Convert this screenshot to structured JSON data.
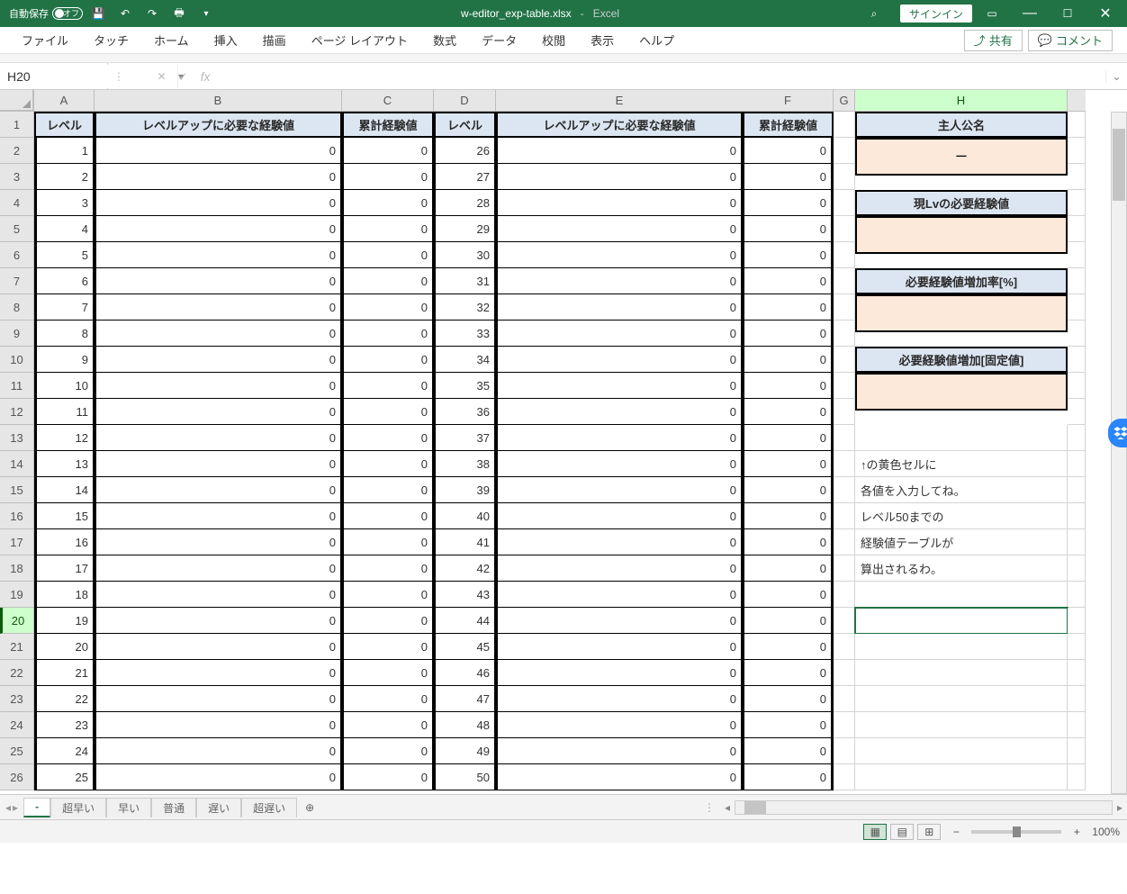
{
  "titlebar": {
    "autosave_label": "自動保存",
    "autosave_state": "オフ",
    "filename": "w-editor_exp-table.xlsx",
    "separator": "-",
    "appname": "Excel",
    "signin": "サインイン"
  },
  "ribbon": {
    "tabs": [
      "ファイル",
      "タッチ",
      "ホーム",
      "挿入",
      "描画",
      "ページ レイアウト",
      "数式",
      "データ",
      "校閲",
      "表示",
      "ヘルプ"
    ],
    "share": "共有",
    "comment": "コメント"
  },
  "namebox": "H20",
  "columns": [
    "A",
    "B",
    "C",
    "D",
    "E",
    "F",
    "G",
    "H"
  ],
  "headers": {
    "level": "レベル",
    "exp_needed": "レベルアップに必要な経験値",
    "cum_exp": "累計経験値"
  },
  "side_headers": {
    "protagonist": "主人公名",
    "current_lv_exp": "現Lvの必要経験値",
    "increase_percent": "必要経験値増加率[%]",
    "increase_fixed": "必要経験値増加[固定値]"
  },
  "side_values": {
    "protagonist": "ー"
  },
  "notes": [
    "↑の黄色セルに",
    "各値を入力してね。",
    "レベル50までの",
    "経験値テーブルが",
    "算出されるわ。"
  ],
  "rows_left": [
    {
      "level": 1,
      "need": 0,
      "cum": 0
    },
    {
      "level": 2,
      "need": 0,
      "cum": 0
    },
    {
      "level": 3,
      "need": 0,
      "cum": 0
    },
    {
      "level": 4,
      "need": 0,
      "cum": 0
    },
    {
      "level": 5,
      "need": 0,
      "cum": 0
    },
    {
      "level": 6,
      "need": 0,
      "cum": 0
    },
    {
      "level": 7,
      "need": 0,
      "cum": 0
    },
    {
      "level": 8,
      "need": 0,
      "cum": 0
    },
    {
      "level": 9,
      "need": 0,
      "cum": 0
    },
    {
      "level": 10,
      "need": 0,
      "cum": 0
    },
    {
      "level": 11,
      "need": 0,
      "cum": 0
    },
    {
      "level": 12,
      "need": 0,
      "cum": 0
    },
    {
      "level": 13,
      "need": 0,
      "cum": 0
    },
    {
      "level": 14,
      "need": 0,
      "cum": 0
    },
    {
      "level": 15,
      "need": 0,
      "cum": 0
    },
    {
      "level": 16,
      "need": 0,
      "cum": 0
    },
    {
      "level": 17,
      "need": 0,
      "cum": 0
    },
    {
      "level": 18,
      "need": 0,
      "cum": 0
    },
    {
      "level": 19,
      "need": 0,
      "cum": 0
    },
    {
      "level": 20,
      "need": 0,
      "cum": 0
    },
    {
      "level": 21,
      "need": 0,
      "cum": 0
    },
    {
      "level": 22,
      "need": 0,
      "cum": 0
    },
    {
      "level": 23,
      "need": 0,
      "cum": 0
    },
    {
      "level": 24,
      "need": 0,
      "cum": 0
    },
    {
      "level": 25,
      "need": 0,
      "cum": 0
    }
  ],
  "rows_right": [
    {
      "level": 26,
      "need": 0,
      "cum": 0
    },
    {
      "level": 27,
      "need": 0,
      "cum": 0
    },
    {
      "level": 28,
      "need": 0,
      "cum": 0
    },
    {
      "level": 29,
      "need": 0,
      "cum": 0
    },
    {
      "level": 30,
      "need": 0,
      "cum": 0
    },
    {
      "level": 31,
      "need": 0,
      "cum": 0
    },
    {
      "level": 32,
      "need": 0,
      "cum": 0
    },
    {
      "level": 33,
      "need": 0,
      "cum": 0
    },
    {
      "level": 34,
      "need": 0,
      "cum": 0
    },
    {
      "level": 35,
      "need": 0,
      "cum": 0
    },
    {
      "level": 36,
      "need": 0,
      "cum": 0
    },
    {
      "level": 37,
      "need": 0,
      "cum": 0
    },
    {
      "level": 38,
      "need": 0,
      "cum": 0
    },
    {
      "level": 39,
      "need": 0,
      "cum": 0
    },
    {
      "level": 40,
      "need": 0,
      "cum": 0
    },
    {
      "level": 41,
      "need": 0,
      "cum": 0
    },
    {
      "level": 42,
      "need": 0,
      "cum": 0
    },
    {
      "level": 43,
      "need": 0,
      "cum": 0
    },
    {
      "level": 44,
      "need": 0,
      "cum": 0
    },
    {
      "level": 45,
      "need": 0,
      "cum": 0
    },
    {
      "level": 46,
      "need": 0,
      "cum": 0
    },
    {
      "level": 47,
      "need": 0,
      "cum": 0
    },
    {
      "level": 48,
      "need": 0,
      "cum": 0
    },
    {
      "level": 49,
      "need": 0,
      "cum": 0
    },
    {
      "level": 50,
      "need": 0,
      "cum": 0
    }
  ],
  "sheet_tabs": [
    "-",
    "超早い",
    "早い",
    "普通",
    "遅い",
    "超遅い"
  ],
  "active_sheet": 0,
  "zoom": "100%"
}
